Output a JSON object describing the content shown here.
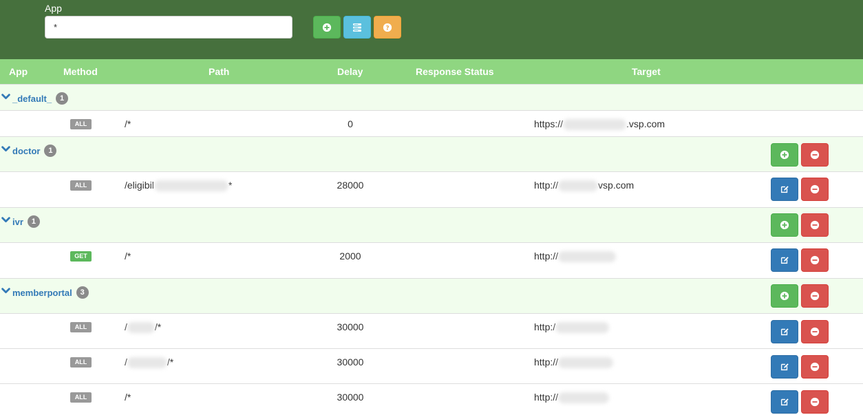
{
  "toolbar": {
    "app_label": "App",
    "app_value": "*",
    "buttons": {
      "add": "plus-circle-icon",
      "list": "server-list-icon",
      "help": "question-circle-icon"
    },
    "colors": {
      "header_bg": "#46703d",
      "add": "#5cb85c",
      "list": "#5bc0de",
      "help": "#f0ad4e"
    }
  },
  "columns": [
    "App",
    "Method",
    "Path",
    "Delay",
    "Response Status",
    "Target"
  ],
  "groups": [
    {
      "name": "_default_",
      "count": "1",
      "rows": [
        {
          "method": "ALL",
          "path": "/*",
          "delay": "0",
          "target_prefix": "https://",
          "target_suffix": ".vsp.com"
        }
      ]
    },
    {
      "name": "doctor",
      "count": "1",
      "rows": [
        {
          "method": "ALL",
          "path_prefix": "/eligibil",
          "path_suffix": "*",
          "delay": "28000",
          "target_prefix": "http://",
          "target_suffix": "vsp.com"
        }
      ]
    },
    {
      "name": "ivr",
      "count": "1",
      "rows": [
        {
          "method": "GET",
          "path": "/*",
          "delay": "2000",
          "target_prefix": "http://"
        }
      ]
    },
    {
      "name": "memberportal",
      "count": "3",
      "rows": [
        {
          "method": "ALL",
          "path_prefix": "/",
          "path_suffix": "/*",
          "delay": "30000",
          "target_prefix": "http:/"
        },
        {
          "method": "ALL",
          "path_prefix": "/",
          "path_suffix": "/*",
          "delay": "30000",
          "target_prefix": "http://"
        },
        {
          "method": "ALL",
          "path": "/*",
          "delay": "30000",
          "target_prefix": "http://"
        }
      ]
    }
  ],
  "row_actions": {
    "add": "plus-circle-icon",
    "edit": "edit-icon",
    "delete": "minus-circle-icon",
    "colors": {
      "add": "#5cb85c",
      "edit": "#337ab7",
      "delete": "#d9534f"
    }
  }
}
